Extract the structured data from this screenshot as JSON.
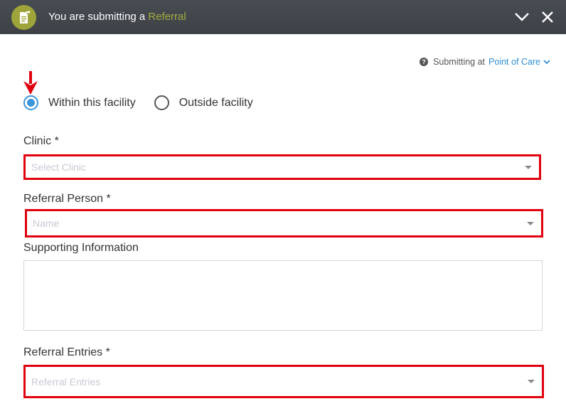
{
  "header": {
    "title_prefix": "You are submitting a",
    "title_accent": "Referral"
  },
  "submitting": {
    "label": "Submitting at",
    "value": "Point of Care"
  },
  "location": {
    "options": [
      {
        "label": "Within this facility",
        "checked": true
      },
      {
        "label": "Outside facility",
        "checked": false
      }
    ]
  },
  "fields": {
    "clinic": {
      "label": "Clinic *",
      "placeholder": "Select Clinic"
    },
    "referral_person": {
      "label": "Referral Person *",
      "placeholder": "Name"
    },
    "supporting_info": {
      "label": "Supporting Information",
      "value": ""
    },
    "referral_entries": {
      "label": "Referral Entries *",
      "placeholder": "Referral Entries"
    }
  },
  "colors": {
    "header_bg": "#44484d",
    "accent": "#a6ad3e",
    "link": "#2f8ed3",
    "highlight": "#e0000e",
    "radio": "#3a96dd"
  },
  "icons": {
    "logo": "referral-document-icon",
    "collapse": "chevron-down-icon",
    "close": "close-icon",
    "help": "question-circle-icon",
    "pointer": "red-arrow-pointer-icon"
  }
}
